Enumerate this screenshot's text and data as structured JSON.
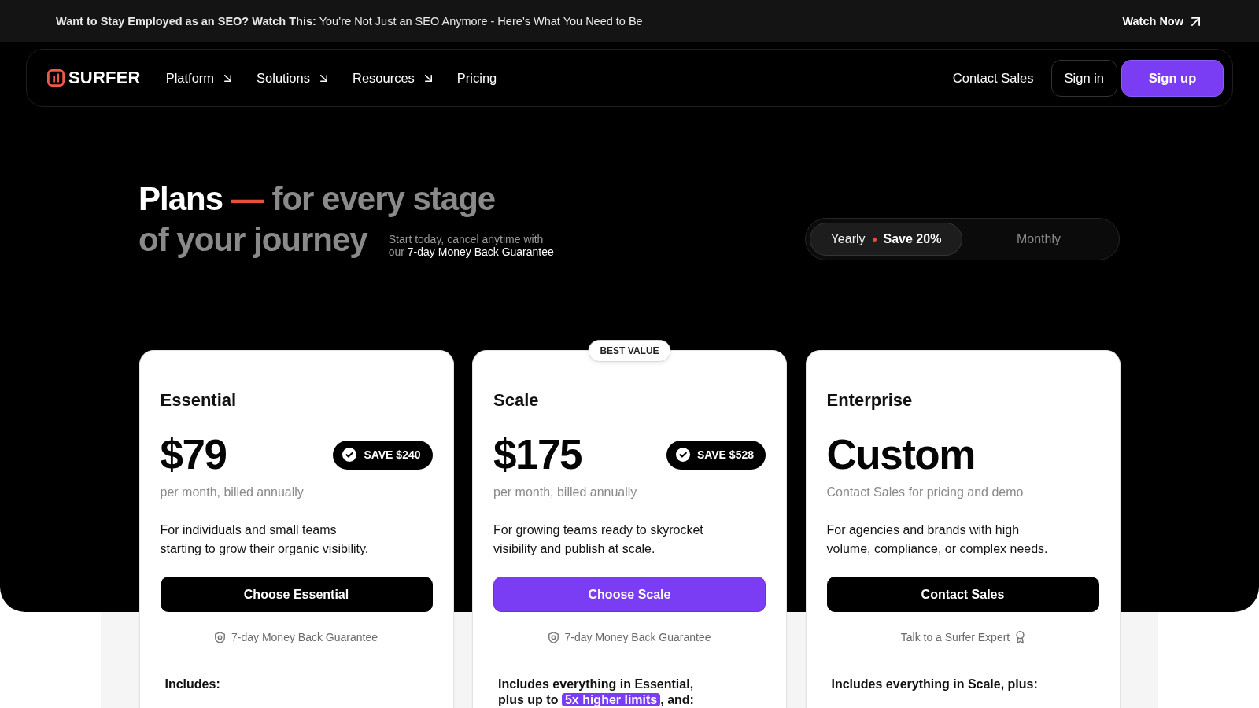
{
  "announcement": {
    "text": "**Want to Stay Employed as an SEO? Watch This:** You’re Not Just an SEO Anymore - Here’s What You Need to Be",
    "link": "Watch Now"
  },
  "nav": {
    "logo": "SURFER",
    "items": [
      {
        "label": "Platform",
        "has_menu": true
      },
      {
        "label": "Solutions",
        "has_menu": true
      },
      {
        "label": "Resources",
        "has_menu": true
      },
      {
        "label": "Pricing",
        "has_menu": false
      }
    ],
    "actions": [
      {
        "label": "Contact Sales",
        "kind": "link"
      },
      {
        "label": "Sign in",
        "kind": "outline"
      },
      {
        "label": "Sign up",
        "kind": "primary"
      }
    ]
  },
  "hero": {
    "title": {
      "lead": "Plans",
      "dash": "—",
      "rest": "for every stage",
      "line_2": "of your journey"
    },
    "note": "Start today, cancel anytime with our",
    "note_link": "7-day Money Back Guarantee"
  },
  "billing": [
    {
      "label": "Yearly",
      "badge": "Save 20%",
      "selected": true
    },
    {
      "label": "Monthly",
      "selected": false
    }
  ],
  "plans": [
    {
      "name": "Essential",
      "price": "$79",
      "savings": "SAVE $240",
      "period": "per month, billed annually",
      "description": [
        "For individuals and small teams",
        "starting to grow their organic visibility."
      ],
      "cta": "Choose Essential",
      "featured": false,
      "note": {
        "kind": "guarantee",
        "text": "7-day Money Back Guarantee"
      },
      "includes": "Includes:"
    },
    {
      "ribbon": "BEST VALUE",
      "name": "Scale",
      "price": "$175",
      "savings": "SAVE $528",
      "period": "per month, billed annually",
      "description": [
        "For growing teams ready to skyrocket",
        "visibility and publish at scale."
      ],
      "cta": "Choose Scale",
      "featured": true,
      "note": {
        "kind": "guarantee",
        "text": "7-day Money Back Guarantee"
      },
      "includes": "Includes everything in Essential, plus up to",
      "includes_highlight": "5x higher limits",
      "includes_end": ", and:"
    },
    {
      "name": "Enterprise",
      "price": "Custom",
      "period": "Contact Sales for pricing and demo",
      "description": [
        "For agencies and brands with high",
        "volume, compliance, or complex needs."
      ],
      "cta": "Contact Sales",
      "featured": false,
      "note": {
        "kind": "expert",
        "text": "Talk to a Surfer Expert"
      },
      "includes": "Includes everything in Scale, plus:"
    }
  ]
}
